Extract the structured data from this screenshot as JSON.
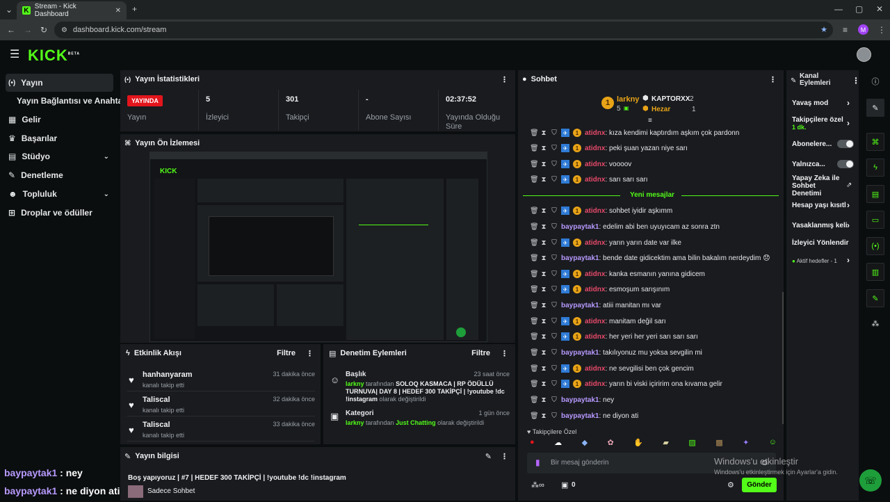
{
  "browser": {
    "tab_title": "Stream - Kick Dashboard",
    "url": "dashboard.kick.com/stream",
    "profile_initial": "M"
  },
  "app": {
    "logo": "KICK",
    "logo_badge": "BETA"
  },
  "sidebar": {
    "items": [
      {
        "label": "Yayın",
        "icon": "broadcast-icon"
      },
      {
        "label": "Yayın Bağlantısı ve Anahtarı",
        "icon": ""
      },
      {
        "label": "Gelir",
        "icon": "revenue-icon"
      },
      {
        "label": "Başarılar",
        "icon": "trophy-icon"
      },
      {
        "label": "Stüdyo",
        "icon": "studio-icon"
      },
      {
        "label": "Denetleme",
        "icon": "wrench-icon"
      },
      {
        "label": "Topluluk",
        "icon": "community-icon"
      },
      {
        "label": "Droplar ve ödüller",
        "icon": "gift-icon"
      }
    ]
  },
  "stats": {
    "title": "Yayın İstatistikleri",
    "live_badge": "YAYINDA",
    "items": [
      {
        "value": "",
        "label": "Yayın"
      },
      {
        "value": "5",
        "label": "İzleyici"
      },
      {
        "value": "301",
        "label": "Takipçi"
      },
      {
        "value": "-",
        "label": "Abone Sayısı"
      },
      {
        "value": "02:37:52",
        "label": "Yayında Olduğu Süre"
      }
    ]
  },
  "preview": {
    "title": "Yayın Ön İzlemesi"
  },
  "activity": {
    "title": "Etkinlik Akışı",
    "filter": "Filtre",
    "rows": [
      {
        "name": "hanhanyaram",
        "sub": "kanalı takip etti",
        "time": "31 dakika önce"
      },
      {
        "name": "Taliscal",
        "sub": "kanalı takip etti",
        "time": "32 dakika önce"
      },
      {
        "name": "Taliscal",
        "sub": "kanalı takip etti",
        "time": "33 dakika önce"
      }
    ]
  },
  "moderation": {
    "title": "Denetim Eylemleri",
    "filter": "Filtre",
    "rows": [
      {
        "title": "Başlık",
        "time": "23 saat önce",
        "user": "larkny",
        "mid": " tarafından ",
        "value": "SOLOQ KASMACA | RP ÖDÜLLÜ TURNUVA| DAY 8 | HEDEF 300 TAKİPÇİ | !youtube !dc !instagram",
        "end": " olarak değiştirildi"
      },
      {
        "title": "Kategori",
        "time": "1 gün önce",
        "user": "larkny",
        "mid": " tarafından ",
        "value": "Just Chatting",
        "end": " olarak değiştirildi"
      }
    ]
  },
  "streaminfo": {
    "title": "Yayın bilgisi",
    "text": "Boş yapıyoruz | #7 | HEDEF 300 TAKİPÇİ | !youtube !dc !instagram",
    "category": "Sadece Sohbet"
  },
  "overlay": {
    "lines": [
      {
        "user": "baypaytak1",
        "text": " : ney"
      },
      {
        "user": "baypaytak1",
        "text": " : ne diyon ati"
      }
    ]
  },
  "chat": {
    "title": "Sohbet",
    "leader": {
      "name": "larkny",
      "count": "5"
    },
    "others": [
      {
        "name": "KAPTORXX",
        "count": "2"
      },
      {
        "name": "Hezar",
        "count": "1"
      }
    ],
    "new_messages": "Yeni mesajlar",
    "messages": [
      {
        "user": "atidnx",
        "text": ": kıza kendimi kaptırdım aşkım çok pardonn",
        "color": "red",
        "badges": true
      },
      {
        "user": "atidnx",
        "text": ": peki şuan yazan niye sarı",
        "color": "red",
        "badges": true
      },
      {
        "user": "atidnx",
        "text": ": voooov",
        "color": "red",
        "badges": true
      },
      {
        "user": "atidnx",
        "text": ": sarı sarı sarı",
        "color": "red",
        "badges": true
      },
      {
        "user": "atidnx",
        "text": ": sohbet iyidir aşkımm",
        "color": "red",
        "badges": true
      },
      {
        "user": "baypaytak1",
        "text": ": edelim abi ben uyuyıcam az sonra ztn",
        "color": "purple",
        "badges": false
      },
      {
        "user": "atidnx",
        "text": ": yarın yarın date var ilke",
        "color": "red",
        "badges": true
      },
      {
        "user": "baypaytak1",
        "text": ": bende date gidicektim ama bilin bakalım nerdeydim 😞",
        "color": "purple",
        "badges": false
      },
      {
        "user": "atidnx",
        "text": ": kanka esmanın yanına gidicem",
        "color": "red",
        "badges": true
      },
      {
        "user": "atidnx",
        "text": ": esmoşum sarışınım",
        "color": "red",
        "badges": true
      },
      {
        "user": "baypaytak1",
        "text": ": atiii manitan mı var",
        "color": "purple",
        "badges": false
      },
      {
        "user": "atidnx",
        "text": ": manitam değil sarı",
        "color": "red",
        "badges": true
      },
      {
        "user": "atidnx",
        "text": ": her yeri her yeri sarı sarı sarı",
        "color": "red",
        "badges": true
      },
      {
        "user": "baypaytak1",
        "text": ": takılıyonuz mu yoksa sevgilin mi",
        "color": "purple",
        "badges": false
      },
      {
        "user": "atidnx",
        "text": ": ne sevgilisi ben çok gencim",
        "color": "red",
        "badges": true
      },
      {
        "user": "atidnx",
        "text": ": yarın bi viski içiririm ona kıvama gelir",
        "color": "red",
        "badges": true
      },
      {
        "user": "baypaytak1",
        "text": ": ney",
        "color": "purple",
        "badges": false
      },
      {
        "user": "baypaytak1",
        "text": ": ne diyon ati",
        "color": "purple",
        "badges": false
      }
    ],
    "followers_only": "Takipçilere Özel",
    "placeholder": "Bir mesaj gönderin",
    "points": "0",
    "send": "Gönder"
  },
  "channel_actions": {
    "title": "Kanal Eylemleri",
    "items": [
      {
        "label": "Yavaş mod",
        "sub": ""
      },
      {
        "label": "Takipçilere özel",
        "sub": "1 dk."
      },
      {
        "label": "Abonelere...",
        "sub": ""
      },
      {
        "label": "Yalnızca...",
        "sub": ""
      },
      {
        "label": "Yapay Zeka ile Sohbet Denetimi",
        "sub": ""
      },
      {
        "label": "Hesap yaşı kısıtl",
        "sub": ""
      },
      {
        "label": "Yasaklanmış keli",
        "sub": ""
      },
      {
        "label": "İzleyici Yönlendir",
        "sub": ""
      },
      {
        "label": "Aktif hedefler - 1",
        "sub": ""
      }
    ]
  },
  "watermark": {
    "line1": "Windows'u etkinleştir",
    "line2": "Windows'u etkinleştirmek için Ayarlar'a gidin."
  },
  "colors": {
    "accent": "#53fc18",
    "live": "#e3151c",
    "panel": "#191b1f"
  }
}
